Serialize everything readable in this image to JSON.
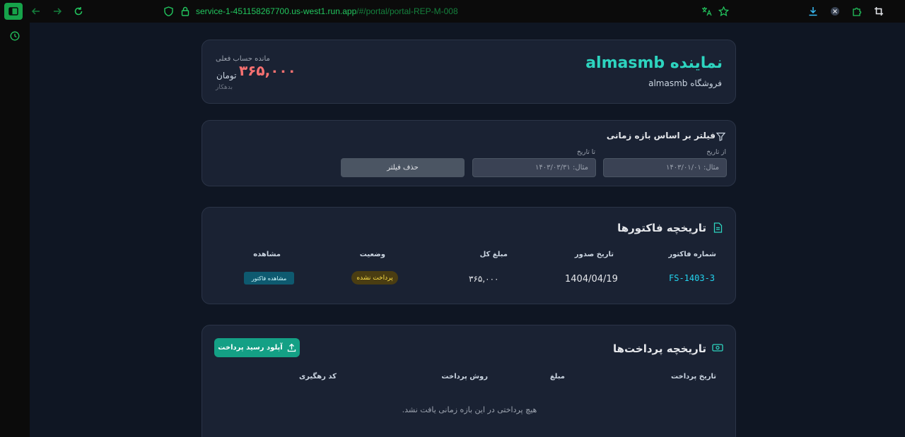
{
  "browser": {
    "url_host": "service-1-451158267700.us-west1.run.app",
    "url_path": "/#/portal/portal-REP-M-008"
  },
  "header": {
    "title": "نماینده almasmb",
    "subtitle": "فروشگاه almasmb",
    "balance_label": "مانده حساب فعلی",
    "balance_amount": "۳۶۵,۰۰۰",
    "balance_unit": "تومان",
    "balance_status": "بدهکار"
  },
  "filter": {
    "title": "فیلتر بر اساس بازه زمانی",
    "from_label": "از تاریخ",
    "from_placeholder": "مثال: ۱۴۰۳/۰۱/۰۱",
    "to_label": "تا تاریخ",
    "to_placeholder": "مثال: ۱۴۰۳/۰۳/۳۱",
    "clear_label": "حذف فیلتر"
  },
  "invoices": {
    "title": "تاریخچه فاکتورها",
    "columns": [
      "شماره فاکتور",
      "تاریخ صدور",
      "مبلغ کل",
      "وضعیت",
      "مشاهده"
    ],
    "rows": [
      {
        "number": "FS-1403-3",
        "date": "1404/04/19",
        "amount": "۳۶۵,۰۰۰",
        "status": "پرداخت نشده",
        "action": "مشاهده فاکتور"
      }
    ]
  },
  "payments": {
    "title": "تاریخچه پرداخت‌ها",
    "upload_label": "آپلود رسید پرداخت",
    "columns": [
      "تاریخ پرداخت",
      "مبلغ",
      "روش پرداخت",
      "کد رهگیری"
    ],
    "empty_text": "هیچ پرداختی در این بازه زمانی یافت نشد."
  },
  "colors": {
    "accent": "#2dd4bf",
    "debt": "#f87171",
    "unpaid_badge": "#fde047",
    "primary_button": "#14a085"
  }
}
